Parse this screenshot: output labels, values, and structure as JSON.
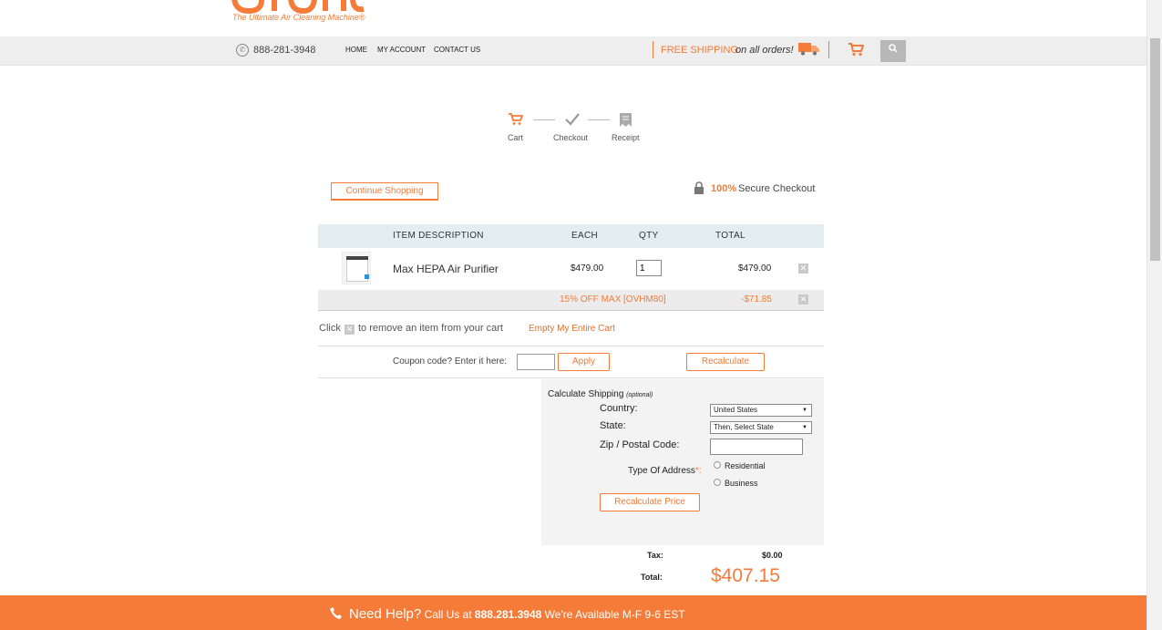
{
  "brand": {
    "tagline": "The Ultimate Air Cleaning Machine®",
    "accent": "#f47b38"
  },
  "topbar": {
    "phone": "888-281-3948",
    "nav": [
      "HOME",
      "MY ACCOUNT",
      "CONTACT US"
    ],
    "shipping_bold": "FREE SHIPPING",
    "shipping_italic": "on all orders!",
    "search_label": "🔍"
  },
  "steps": [
    {
      "label": "Cart",
      "icon": "cart-icon"
    },
    {
      "label": "Checkout",
      "icon": "checkmark-icon"
    },
    {
      "label": "Receipt",
      "icon": "receipt-icon"
    }
  ],
  "actions": {
    "continue_shopping": "Continue Shopping",
    "secure_pct": "100%",
    "secure_text": "Secure Checkout"
  },
  "cart": {
    "headers": {
      "item": "ITEM  DESCRIPTION",
      "each": "EACH",
      "qty": "QTY",
      "total": "TOTAL"
    },
    "items": [
      {
        "name": "Max HEPA Air Purifier",
        "each": "$479.00",
        "qty": "1",
        "total": "$479.00"
      }
    ],
    "discount": {
      "label": "15% OFF MAX [OVHM80]",
      "amount": "-$71.85"
    },
    "remove_note_pre": "Click",
    "remove_note_post": "to remove an item from your cart",
    "empty_cart": "Empty My Entire Cart"
  },
  "coupon": {
    "label": "Coupon code? Enter it here:",
    "value": "",
    "apply": "Apply",
    "recalculate": "Recalculate"
  },
  "shipping": {
    "title": "Calculate Shipping",
    "optional": "(optional)",
    "country_label": "Country:",
    "country_value": "United States",
    "state_label": "State:",
    "state_value": "Then, Select State",
    "zip_label": "Zip / Postal Code:",
    "zip_value": "",
    "address_type_label": "Type Of Address",
    "required_mark": "*:",
    "residential": "Residential",
    "business": "Business",
    "recalc_price": "Recalculate Price"
  },
  "totals": {
    "tax_label": "Tax:",
    "tax_value": "$0.00",
    "total_label": "Total:",
    "total_value": "$407.15"
  },
  "footer": {
    "need_help": "Need Help?",
    "call_us": "Call Us at",
    "phone": "888.281.3948",
    "hours": "We're Available M-F 9-6 EST"
  }
}
